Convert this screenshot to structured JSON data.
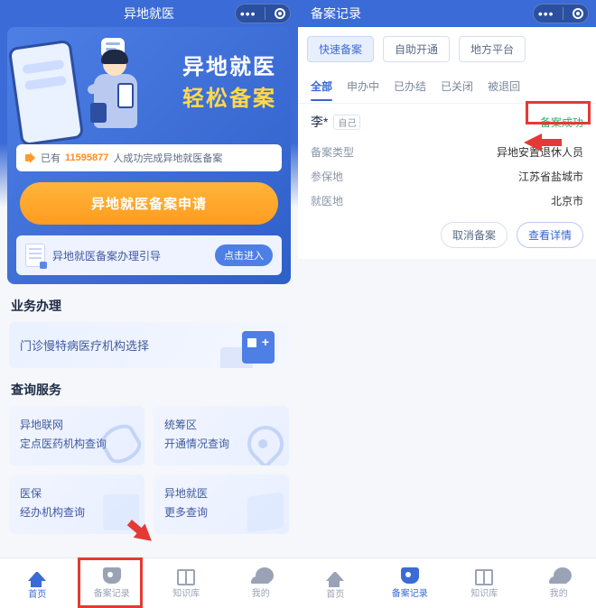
{
  "left": {
    "header_title": "异地就医",
    "slogan_line1": "异地就医",
    "slogan_line2": "轻松备案",
    "count_prefix": "已有",
    "count_number": "11595877",
    "count_suffix": "人成功完成异地就医备案",
    "apply_button": "异地就医备案申请",
    "guide_text": "异地就医备案办理引导",
    "guide_button": "点击进入",
    "section_biz": "业务办理",
    "biz_card_label": "门诊慢特病医疗机构选择",
    "section_query": "查询服务",
    "query_cards": [
      {
        "line1": "异地联网",
        "line2": "定点医药机构查询"
      },
      {
        "line1": "统筹区",
        "line2": "开通情况查询"
      },
      {
        "line1": "医保",
        "line2": "经办机构查询"
      },
      {
        "line1": "异地就医",
        "line2": "更多查询"
      }
    ],
    "tabs": [
      "首页",
      "备案记录",
      "知识库",
      "我的"
    ]
  },
  "right": {
    "header_title": "备案记录",
    "chips": [
      "快速备案",
      "自助开通",
      "地方平台"
    ],
    "tabs": [
      "全部",
      "申办中",
      "已办结",
      "已关闭",
      "被退回"
    ],
    "record": {
      "name": "李*",
      "self_tag": "自己",
      "status": "备案成功",
      "rows": [
        {
          "k": "备案类型",
          "v": "异地安置退休人员"
        },
        {
          "k": "参保地",
          "v": "江苏省盐城市"
        },
        {
          "k": "就医地",
          "v": "北京市"
        }
      ],
      "actions": {
        "cancel": "取消备案",
        "detail": "查看详情"
      }
    },
    "tabs_bottom": [
      "首页",
      "备案记录",
      "知识库",
      "我的"
    ]
  }
}
